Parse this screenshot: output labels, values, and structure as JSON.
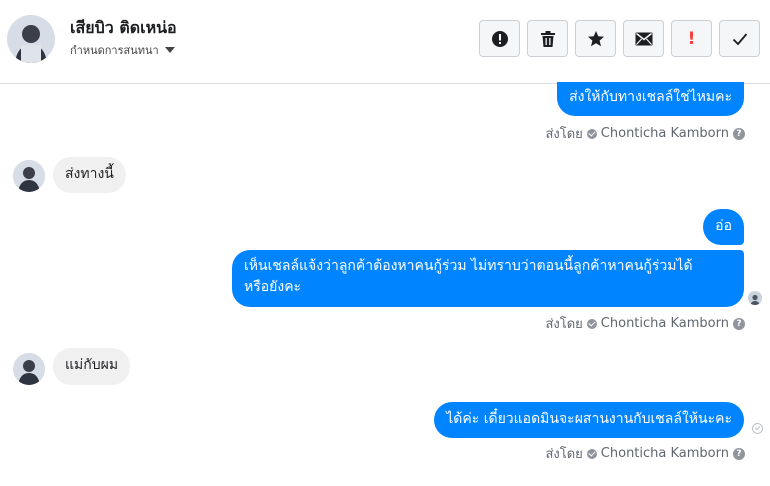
{
  "header": {
    "contact_name": "เสียบิว ติดเหน่อ",
    "assign_label": "กำหนดการสนทนา"
  },
  "toolbar": {
    "buttons": [
      {
        "icon": "alert-circle-icon"
      },
      {
        "icon": "trash-icon"
      },
      {
        "icon": "star-icon"
      },
      {
        "icon": "mail-icon"
      },
      {
        "icon": "exclamation-icon",
        "text": "!",
        "color": "#fa3e3e"
      },
      {
        "icon": "checkmark-icon"
      }
    ]
  },
  "messages": [
    {
      "direction": "out",
      "text": "ส่งให้กับทางเชลล์ใช่ไหมคะ"
    },
    {
      "direction": "in",
      "text": "ส่งทางนี้"
    },
    {
      "direction": "out",
      "text": "อ่อ"
    },
    {
      "direction": "out",
      "text_line1": "เห็นเชลล์แจ้งว่าลูกค้าต้องหาคนกู้ร่วม ไม่ทราบว่าตอนนี้ลูกค้าหาคนกู้ร่วมได้",
      "text_line2": "หรือยังคะ"
    },
    {
      "direction": "in",
      "text": "แม่กับผม"
    },
    {
      "direction": "out",
      "text": "ได้ค่ะ เดี๋ยวแอดมินจะผสานงานกับเชลล์ให้นะคะ"
    }
  ],
  "sent_by": {
    "prefix": "ส่งโดย",
    "agent": "Chonticha Kamborn",
    "help": "?"
  },
  "colors": {
    "outgoing_bubble": "#0084ff",
    "incoming_bubble": "#f1f0f0",
    "alert_red": "#fa3e3e"
  }
}
